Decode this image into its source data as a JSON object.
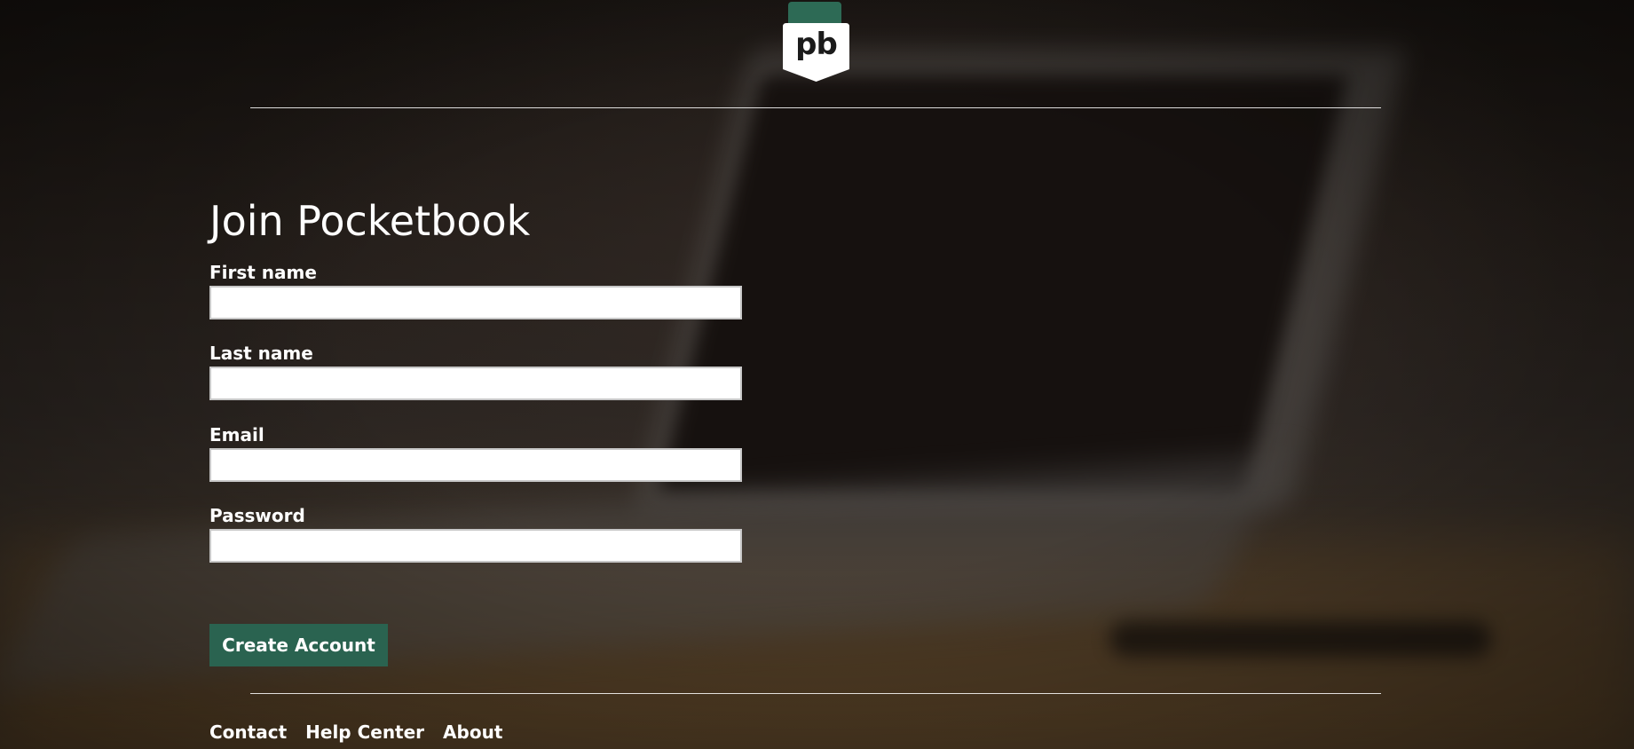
{
  "logo": {
    "text": "pb",
    "card_color": "#2d6a55"
  },
  "form": {
    "title": "Join Pocketbook",
    "fields": [
      {
        "label": "First name",
        "value": "",
        "placeholder": ""
      },
      {
        "label": "Last name",
        "value": "",
        "placeholder": ""
      },
      {
        "label": "Email",
        "value": "",
        "placeholder": ""
      },
      {
        "label": "Password",
        "value": "",
        "placeholder": ""
      }
    ],
    "submit_label": "Create Account",
    "submit_color": "#2a6350"
  },
  "footer": {
    "links": [
      "Contact",
      "Help Center",
      "About"
    ]
  }
}
